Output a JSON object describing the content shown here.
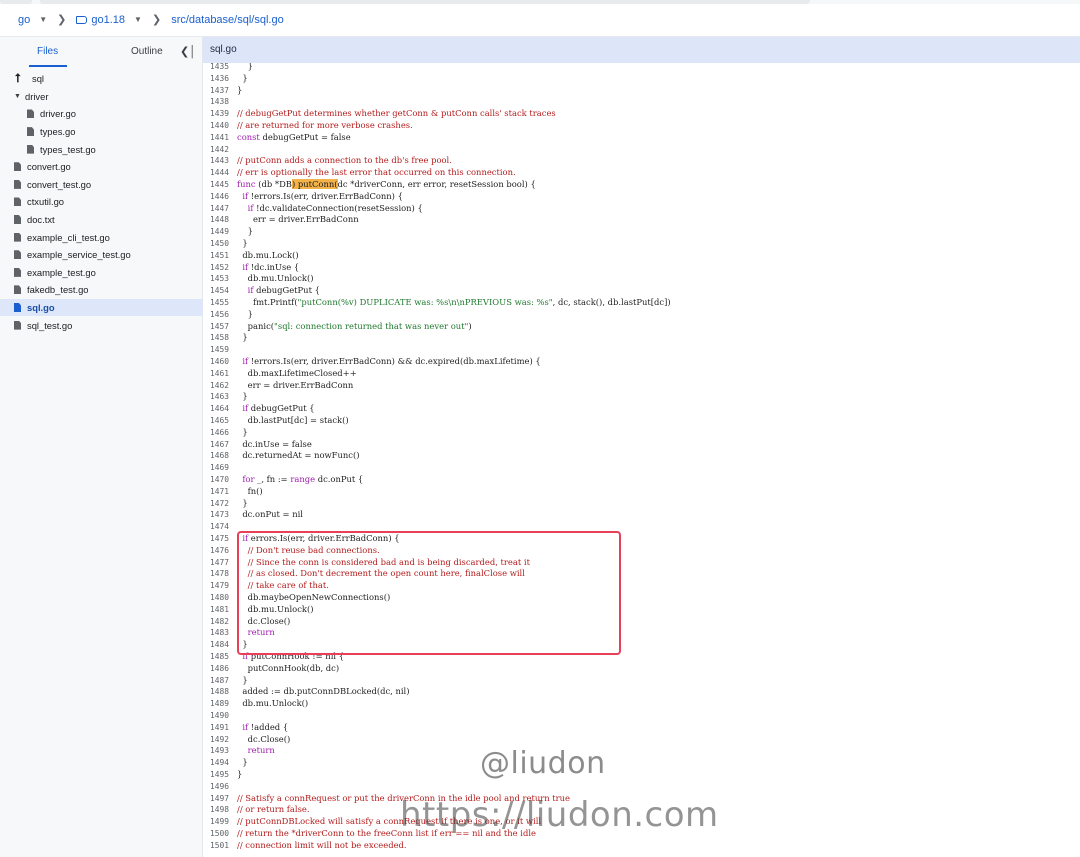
{
  "breadcrumb": {
    "repo": "go",
    "version": "go1.18",
    "path": "src/database/sql/sql.go"
  },
  "sidebar": {
    "tabs": [
      {
        "label": "Files",
        "active": true
      },
      {
        "label": "Outline",
        "active": false
      }
    ],
    "collapse_icon": "collapse-panel-icon",
    "items": [
      {
        "label": "sql",
        "kind": "up",
        "indent": 0
      },
      {
        "label": "driver",
        "kind": "folder-open",
        "indent": 0
      },
      {
        "label": "driver.go",
        "kind": "file",
        "indent": 1
      },
      {
        "label": "types.go",
        "kind": "file",
        "indent": 1
      },
      {
        "label": "types_test.go",
        "kind": "file",
        "indent": 1
      },
      {
        "label": "convert.go",
        "kind": "file",
        "indent": 0
      },
      {
        "label": "convert_test.go",
        "kind": "file",
        "indent": 0
      },
      {
        "label": "ctxutil.go",
        "kind": "file",
        "indent": 0
      },
      {
        "label": "doc.txt",
        "kind": "file",
        "indent": 0
      },
      {
        "label": "example_cli_test.go",
        "kind": "file",
        "indent": 0
      },
      {
        "label": "example_service_test.go",
        "kind": "file",
        "indent": 0
      },
      {
        "label": "example_test.go",
        "kind": "file",
        "indent": 0
      },
      {
        "label": "fakedb_test.go",
        "kind": "file",
        "indent": 0
      },
      {
        "label": "sql.go",
        "kind": "file",
        "indent": 0,
        "selected": true
      },
      {
        "label": "sql_test.go",
        "kind": "file",
        "indent": 0
      }
    ]
  },
  "editor": {
    "tab_label": "sql.go",
    "lines": [
      {
        "n": "1435",
        "t": [
          [
            "pl",
            "    }"
          ]
        ]
      },
      {
        "n": "1436",
        "t": [
          [
            "pl",
            "  }"
          ]
        ]
      },
      {
        "n": "1437",
        "t": [
          [
            "pl",
            "}"
          ]
        ]
      },
      {
        "n": "1438",
        "t": []
      },
      {
        "n": "1439",
        "t": [
          [
            "cm",
            "// debugGetPut determines whether getConn & putConn calls' stack traces"
          ]
        ]
      },
      {
        "n": "1440",
        "t": [
          [
            "cm",
            "// are returned for more verbose crashes."
          ]
        ]
      },
      {
        "n": "1441",
        "t": [
          [
            "kw",
            "const"
          ],
          [
            "pl",
            " debugGetPut = false"
          ]
        ]
      },
      {
        "n": "1442",
        "t": []
      },
      {
        "n": "1443",
        "t": [
          [
            "cm",
            "// putConn adds a connection to the db's free pool."
          ]
        ]
      },
      {
        "n": "1444",
        "t": [
          [
            "cm",
            "// err is optionally the last error that occurred on this connection."
          ]
        ]
      },
      {
        "n": "1445",
        "t": [
          [
            "kw",
            "func"
          ],
          [
            "pl",
            " (db *DB"
          ],
          [
            "hl",
            ") putConn("
          ],
          [
            "pl",
            "dc *driverConn, err error, resetSession bool) {"
          ]
        ]
      },
      {
        "n": "1446",
        "t": [
          [
            "pl",
            "  "
          ],
          [
            "kw",
            "if"
          ],
          [
            "pl",
            " !errors.Is(err, driver.ErrBadConn) {"
          ]
        ]
      },
      {
        "n": "1447",
        "t": [
          [
            "pl",
            "    "
          ],
          [
            "kw",
            "if"
          ],
          [
            "pl",
            " !dc.validateConnection(resetSession) {"
          ]
        ]
      },
      {
        "n": "1448",
        "t": [
          [
            "pl",
            "      err = driver.ErrBadConn"
          ]
        ]
      },
      {
        "n": "1449",
        "t": [
          [
            "pl",
            "    }"
          ]
        ]
      },
      {
        "n": "1450",
        "t": [
          [
            "pl",
            "  }"
          ]
        ]
      },
      {
        "n": "1451",
        "t": [
          [
            "pl",
            "  db.mu.Lock()"
          ]
        ]
      },
      {
        "n": "1452",
        "t": [
          [
            "pl",
            "  "
          ],
          [
            "kw",
            "if"
          ],
          [
            "pl",
            " !dc.inUse {"
          ]
        ]
      },
      {
        "n": "1453",
        "t": [
          [
            "pl",
            "    db.mu.Unlock()"
          ]
        ]
      },
      {
        "n": "1454",
        "t": [
          [
            "pl",
            "    "
          ],
          [
            "kw",
            "if"
          ],
          [
            "pl",
            " debugGetPut {"
          ]
        ]
      },
      {
        "n": "1455",
        "t": [
          [
            "pl",
            "      fmt.Printf("
          ],
          [
            "st",
            "\"putConn(%v) DUPLICATE was: %s\\n\\nPREVIOUS was: %s\""
          ],
          [
            "pl",
            ", dc, stack(), db.lastPut[dc])"
          ]
        ]
      },
      {
        "n": "1456",
        "t": [
          [
            "pl",
            "    }"
          ]
        ]
      },
      {
        "n": "1457",
        "t": [
          [
            "pl",
            "    panic("
          ],
          [
            "st",
            "\"sql: connection returned that was never out\""
          ],
          [
            "pl",
            ")"
          ]
        ]
      },
      {
        "n": "1458",
        "t": [
          [
            "pl",
            "  }"
          ]
        ]
      },
      {
        "n": "1459",
        "t": []
      },
      {
        "n": "1460",
        "t": [
          [
            "pl",
            "  "
          ],
          [
            "kw",
            "if"
          ],
          [
            "pl",
            " !errors.Is(err, driver.ErrBadConn) && dc.expired(db.maxLifetime) {"
          ]
        ]
      },
      {
        "n": "1461",
        "t": [
          [
            "pl",
            "    db.maxLifetimeClosed++"
          ]
        ]
      },
      {
        "n": "1462",
        "t": [
          [
            "pl",
            "    err = driver.ErrBadConn"
          ]
        ]
      },
      {
        "n": "1463",
        "t": [
          [
            "pl",
            "  }"
          ]
        ]
      },
      {
        "n": "1464",
        "t": [
          [
            "pl",
            "  "
          ],
          [
            "kw",
            "if"
          ],
          [
            "pl",
            " debugGetPut {"
          ]
        ]
      },
      {
        "n": "1465",
        "t": [
          [
            "pl",
            "    db.lastPut[dc] = stack()"
          ]
        ]
      },
      {
        "n": "1466",
        "t": [
          [
            "pl",
            "  }"
          ]
        ]
      },
      {
        "n": "1467",
        "t": [
          [
            "pl",
            "  dc.inUse = false"
          ]
        ]
      },
      {
        "n": "1468",
        "t": [
          [
            "pl",
            "  dc.returnedAt = nowFunc()"
          ]
        ]
      },
      {
        "n": "1469",
        "t": []
      },
      {
        "n": "1470",
        "t": [
          [
            "pl",
            "  "
          ],
          [
            "kw",
            "for"
          ],
          [
            "pl",
            " _, fn := "
          ],
          [
            "kw",
            "range"
          ],
          [
            "pl",
            " dc.onPut {"
          ]
        ]
      },
      {
        "n": "1471",
        "t": [
          [
            "pl",
            "    fn()"
          ]
        ]
      },
      {
        "n": "1472",
        "t": [
          [
            "pl",
            "  }"
          ]
        ]
      },
      {
        "n": "1473",
        "t": [
          [
            "pl",
            "  dc.onPut = nil"
          ]
        ]
      },
      {
        "n": "1474",
        "t": []
      },
      {
        "n": "1475",
        "t": [
          [
            "pl",
            "  "
          ],
          [
            "kw",
            "if"
          ],
          [
            "pl",
            " errors.Is(err, driver.ErrBadConn) {"
          ]
        ]
      },
      {
        "n": "1476",
        "t": [
          [
            "pl",
            "    "
          ],
          [
            "cm",
            "// Don't reuse bad connections."
          ]
        ]
      },
      {
        "n": "1477",
        "t": [
          [
            "pl",
            "    "
          ],
          [
            "cm",
            "// Since the conn is considered bad and is being discarded, treat it"
          ]
        ]
      },
      {
        "n": "1478",
        "t": [
          [
            "pl",
            "    "
          ],
          [
            "cm",
            "// as closed. Don't decrement the open count here, finalClose will"
          ]
        ]
      },
      {
        "n": "1479",
        "t": [
          [
            "pl",
            "    "
          ],
          [
            "cm",
            "// take care of that."
          ]
        ]
      },
      {
        "n": "1480",
        "t": [
          [
            "pl",
            "    db.maybeOpenNewConnections()"
          ]
        ]
      },
      {
        "n": "1481",
        "t": [
          [
            "pl",
            "    db.mu.Unlock()"
          ]
        ]
      },
      {
        "n": "1482",
        "t": [
          [
            "pl",
            "    dc.Close()"
          ]
        ]
      },
      {
        "n": "1483",
        "t": [
          [
            "pl",
            "    "
          ],
          [
            "kw",
            "return"
          ]
        ]
      },
      {
        "n": "1484",
        "t": [
          [
            "pl",
            "  }"
          ]
        ]
      },
      {
        "n": "1485",
        "t": [
          [
            "pl",
            "  "
          ],
          [
            "kw",
            "if"
          ],
          [
            "pl",
            " putConnHook != nil {"
          ]
        ]
      },
      {
        "n": "1486",
        "t": [
          [
            "pl",
            "    putConnHook(db, dc)"
          ]
        ]
      },
      {
        "n": "1487",
        "t": [
          [
            "pl",
            "  }"
          ]
        ]
      },
      {
        "n": "1488",
        "t": [
          [
            "pl",
            "  added := db.putConnDBLocked(dc, nil)"
          ]
        ]
      },
      {
        "n": "1489",
        "t": [
          [
            "pl",
            "  db.mu.Unlock()"
          ]
        ]
      },
      {
        "n": "1490",
        "t": []
      },
      {
        "n": "1491",
        "t": [
          [
            "pl",
            "  "
          ],
          [
            "kw",
            "if"
          ],
          [
            "pl",
            " !added {"
          ]
        ]
      },
      {
        "n": "1492",
        "t": [
          [
            "pl",
            "    dc.Close()"
          ]
        ]
      },
      {
        "n": "1493",
        "t": [
          [
            "pl",
            "    "
          ],
          [
            "kw",
            "return"
          ]
        ]
      },
      {
        "n": "1494",
        "t": [
          [
            "pl",
            "  }"
          ]
        ]
      },
      {
        "n": "1495",
        "t": [
          [
            "pl",
            "}"
          ]
        ]
      },
      {
        "n": "1496",
        "t": []
      },
      {
        "n": "1497",
        "t": [
          [
            "cm",
            "// Satisfy a connRequest or put the driverConn in the idle pool and return true"
          ]
        ]
      },
      {
        "n": "1498",
        "t": [
          [
            "cm",
            "// or return false."
          ]
        ]
      },
      {
        "n": "1499",
        "t": [
          [
            "cm",
            "// putConnDBLocked will satisfy a connRequest if there is one, or it will"
          ]
        ]
      },
      {
        "n": "1500",
        "t": [
          [
            "cm",
            "// return the *driverConn to the freeConn list if err == nil and the idle"
          ]
        ]
      },
      {
        "n": "1501",
        "t": [
          [
            "cm",
            "// connection limit will not be exceeded."
          ]
        ]
      }
    ]
  },
  "watermark": {
    "handle": "@liudon",
    "url": "https://liudon.com"
  },
  "colors": {
    "accent": "#1a5fd0",
    "keyword": "#a01bb0",
    "comment": "#b41c1c",
    "string": "#1f7a2e",
    "highlight": "#f3b34a",
    "box": "#e9405a"
  }
}
